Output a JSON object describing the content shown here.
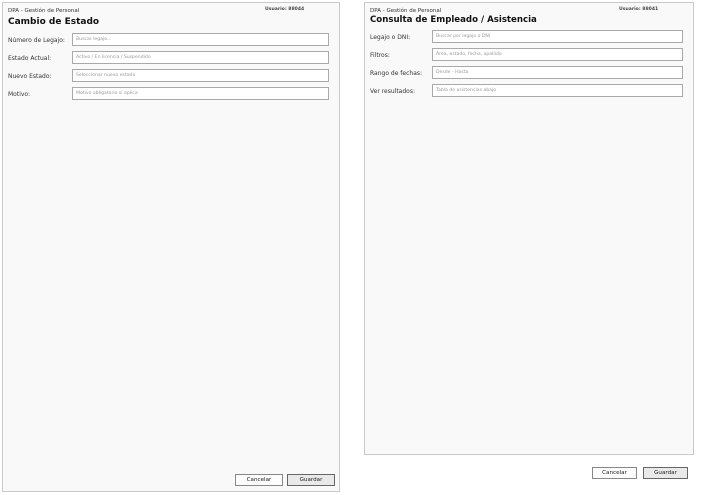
{
  "left_window": {
    "app_title": "DPA - Gestión de Personal",
    "user": "Usuario: 88044",
    "form_title": "Cambio de Estado",
    "fields": [
      {
        "label": "Número de Legajo:",
        "placeholder": "Buscar legajo..."
      },
      {
        "label": "Estado Actual:",
        "placeholder": "Activo / En licencia / Suspendido"
      },
      {
        "label": "Nuevo Estado:",
        "placeholder": "Seleccionar nuevo estado"
      },
      {
        "label": "Motivo:",
        "placeholder": "Motivo obligatorio si aplica"
      }
    ],
    "buttons": {
      "cancel": "Cancelar",
      "save": "Guardar"
    }
  },
  "right_window": {
    "app_title": "DPA - Gestión de Personal",
    "user": "Usuario: 88041",
    "form_title": "Consulta de Empleado / Asistencia",
    "fields": [
      {
        "label": "Legajo o DNI:",
        "placeholder": "Buscar por legajo o DNI"
      },
      {
        "label": "Filtros:",
        "placeholder": "Área, estado, fecha, apellido"
      },
      {
        "label": "Rango de fechas:",
        "placeholder": "Desde - Hasta"
      },
      {
        "label": "Ver resultados:",
        "placeholder": "Tabla de asistencias abajo"
      }
    ],
    "buttons": {
      "cancel": "Cancelar",
      "save": "Guardar"
    }
  }
}
